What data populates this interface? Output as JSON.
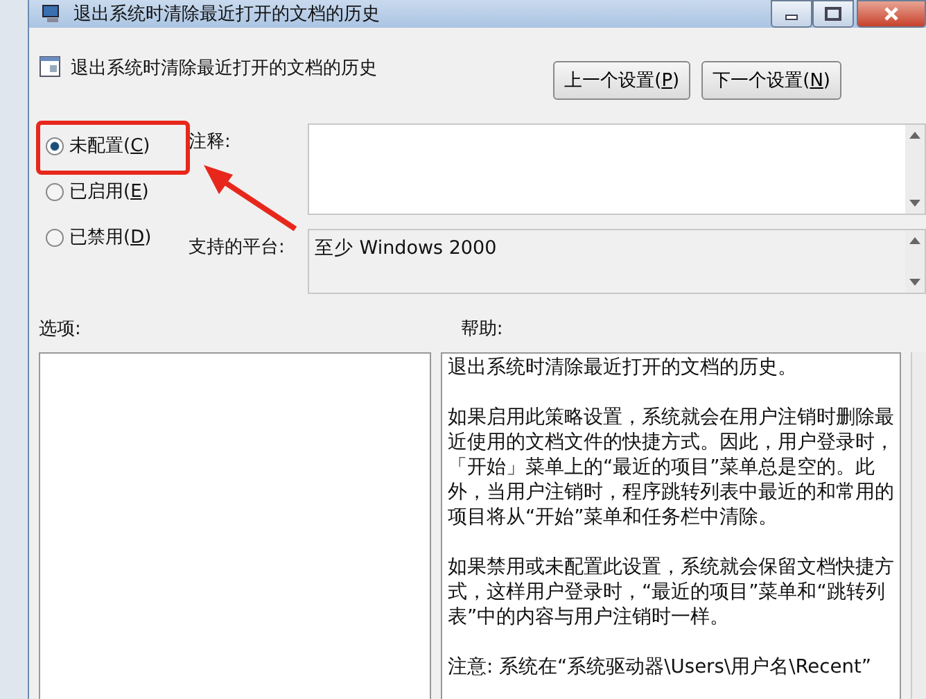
{
  "window": {
    "title": "退出系统时清除最近打开的文档的历史"
  },
  "header": {
    "title": "退出系统时清除最近打开的文档的历史"
  },
  "buttons": [
    {
      "label": "上一个设置(",
      "key": "P",
      "end": ")"
    },
    {
      "label": "下一个设置(",
      "key": "N",
      "end": ")"
    }
  ],
  "states": [
    {
      "label": "未配置(",
      "key": "C",
      "end": ")",
      "selected": true
    },
    {
      "label": "已启用(",
      "key": "E",
      "end": ")",
      "selected": false
    },
    {
      "label": "已禁用(",
      "key": "D",
      "end": ")",
      "selected": false
    }
  ],
  "comment": {
    "label": "注释:"
  },
  "platform": {
    "label": "支持的平台:",
    "value": "至少 Windows 2000"
  },
  "options": {
    "label": "选项:"
  },
  "help": {
    "label": "帮助:",
    "paragraphs": [
      "退出系统时清除最近打开的文档的历史。",
      "如果启用此策略设置，系统就会在用户注销时删除最近使用的文档文件的快捷方式。因此，用户登录时，「开始」菜单上的“最近的项目”菜单总是空的。此外，当用户注销时，程序跳转列表中最近的和常用的项目将从“开始”菜单和任务栏中清除。",
      "如果禁用或未配置此设置，系统就会保留文档快捷方式，这样用户登录时，“最近的项目”菜单和“跳转列表”中的内容与用户注销时一样。",
      "注意: 系统在“系统驱动器\\Users\\用户名\\Recent”"
    ]
  }
}
